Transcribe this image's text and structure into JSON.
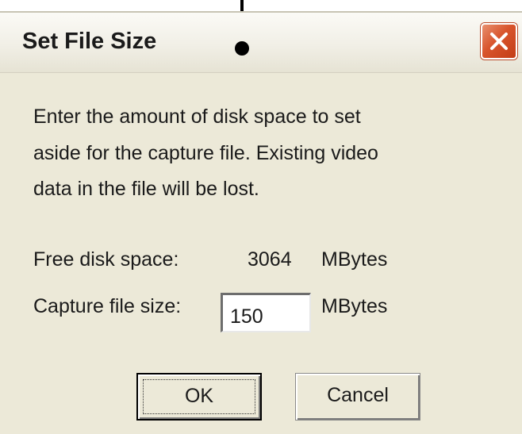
{
  "window": {
    "title": "Set File Size",
    "close_icon": "close-icon"
  },
  "message": {
    "line1": "Enter the amount of disk space to set",
    "line2": "aside for the capture file.  Existing video",
    "line3": "data in the file will be lost."
  },
  "free_space": {
    "label": "Free disk space:",
    "value": "3064",
    "unit": "MBytes"
  },
  "capture_size": {
    "label": "Capture file size:",
    "value": "150",
    "unit": "MBytes"
  },
  "buttons": {
    "ok_label": "OK",
    "cancel_label": "Cancel"
  },
  "colors": {
    "dialog_bg": "#ece9d8",
    "close_button": "#d8542c"
  }
}
